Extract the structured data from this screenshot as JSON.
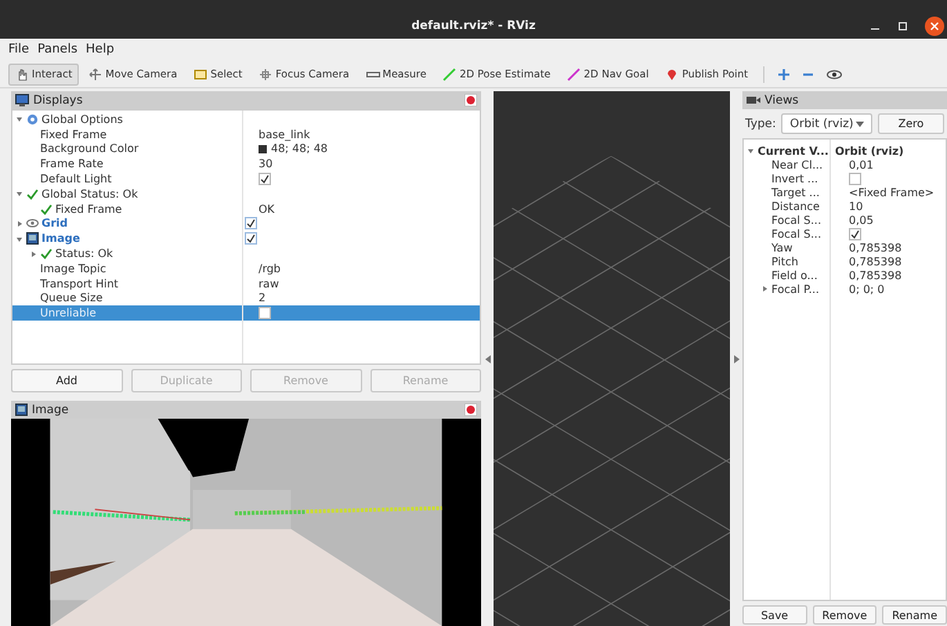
{
  "window": {
    "title": "default.rviz* - RViz"
  },
  "menu": [
    "File",
    "Panels",
    "Help"
  ],
  "toolbar": [
    {
      "label": "Interact",
      "kind": "interact",
      "selected": true
    },
    {
      "label": "Move Camera",
      "kind": "move",
      "selected": false
    },
    {
      "label": "Select",
      "kind": "select",
      "selected": false
    },
    {
      "label": "Focus Camera",
      "kind": "focus",
      "selected": false
    },
    {
      "label": "Measure",
      "kind": "measure",
      "selected": false
    },
    {
      "label": "2D Pose Estimate",
      "kind": "pose",
      "selected": false
    },
    {
      "label": "2D Nav Goal",
      "kind": "goal",
      "selected": false
    },
    {
      "label": "Publish Point",
      "kind": "point",
      "selected": false
    }
  ],
  "displays": {
    "title": "Displays",
    "tree": [
      {
        "label": "Global Options",
        "kind": "options",
        "expanded": true,
        "selected": false,
        "children": [
          {
            "label": "Fixed Frame",
            "kind": "text",
            "value": "base_link",
            "selected": false
          },
          {
            "label": "Background Color",
            "kind": "color",
            "value": "48; 48; 48",
            "color": "#303030",
            "selected": false
          },
          {
            "label": "Frame Rate",
            "kind": "text",
            "value": "30",
            "selected": false
          },
          {
            "label": "Default Light",
            "kind": "check",
            "checked": true,
            "selected": false
          }
        ]
      },
      {
        "label": "Global Status: Ok",
        "kind": "status",
        "expanded": true,
        "selected": false,
        "children": [
          {
            "label": "Fixed Frame",
            "kind": "status",
            "value": "OK",
            "selected": false
          }
        ]
      },
      {
        "label": "Grid",
        "kind": "grid",
        "expanded": false,
        "checked": true,
        "selected": false
      },
      {
        "label": "Image",
        "kind": "image",
        "expanded": true,
        "checked": true,
        "selected": false,
        "children": [
          {
            "label": "Status: Ok",
            "kind": "status",
            "expanded": false,
            "selected": false
          },
          {
            "label": "Image Topic",
            "kind": "text",
            "value": "/rgb",
            "selected": false
          },
          {
            "label": "Transport Hint",
            "kind": "text",
            "value": "raw",
            "selected": false
          },
          {
            "label": "Queue Size",
            "kind": "text",
            "value": "2",
            "selected": false
          },
          {
            "label": "Unreliable",
            "kind": "check",
            "checked": false,
            "selected": true
          }
        ]
      }
    ],
    "buttons": [
      {
        "label": "Add",
        "disabled": false
      },
      {
        "label": "Duplicate",
        "disabled": true
      },
      {
        "label": "Remove",
        "disabled": true
      },
      {
        "label": "Rename",
        "disabled": true
      }
    ]
  },
  "image_panel": {
    "title": "Image"
  },
  "views": {
    "title": "Views",
    "type_label": "Type:",
    "type_value": "Orbit (rviz)",
    "zero_button": "Zero",
    "tree": [
      {
        "label": "Current V...",
        "kind": "header",
        "value": "Orbit (rviz)",
        "expanded": true,
        "children": [
          {
            "label": "Near Cl...",
            "value": "0,01"
          },
          {
            "label": "Invert ...",
            "checked": false
          },
          {
            "label": "Target ...",
            "value": "<Fixed Frame>"
          },
          {
            "label": "Distance",
            "value": "10"
          },
          {
            "label": "Focal S...",
            "value": "0,05"
          },
          {
            "label": "Focal S...",
            "checked": true
          },
          {
            "label": "Yaw",
            "value": "0,785398"
          },
          {
            "label": "Pitch",
            "value": "0,785398"
          },
          {
            "label": "Field o...",
            "value": "0,785398"
          },
          {
            "label": "Focal P...",
            "value": "0; 0; 0",
            "expanded": false
          }
        ]
      }
    ],
    "buttons": [
      "Save",
      "Remove",
      "Rename"
    ]
  }
}
